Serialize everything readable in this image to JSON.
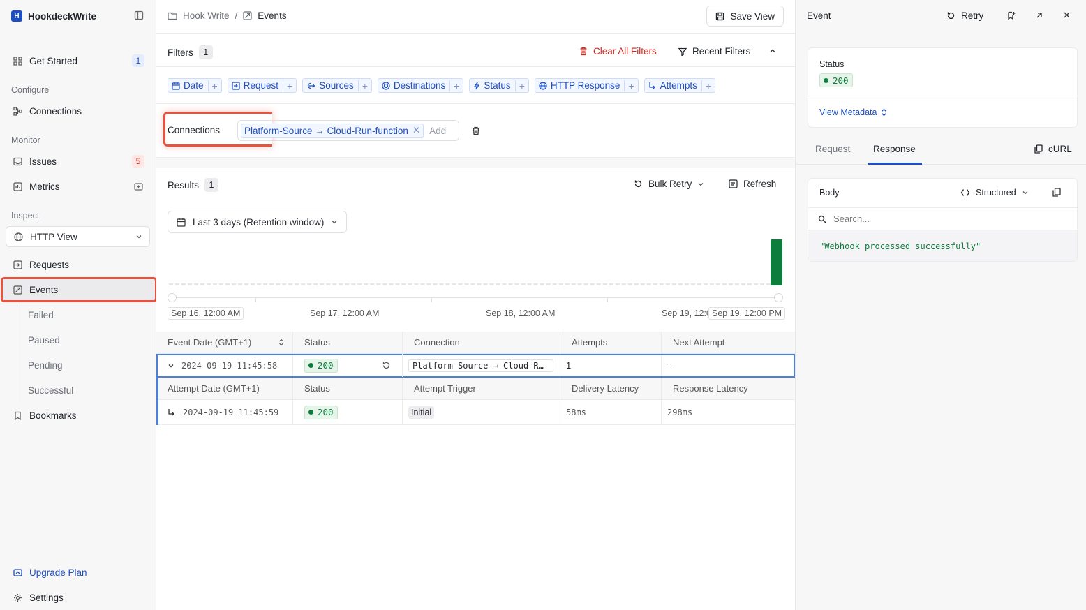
{
  "sidebar": {
    "brand": {
      "logo_letter": "H",
      "name": "HookdeckWrite"
    },
    "get_started": {
      "label": "Get Started",
      "count": "1"
    },
    "sections": {
      "configure": "Configure",
      "monitor": "Monitor",
      "inspect": "Inspect"
    },
    "connections": "Connections",
    "issues": {
      "label": "Issues",
      "count": "5"
    },
    "metrics": "Metrics",
    "http_view": "HTTP View",
    "requests": "Requests",
    "events": "Events",
    "event_subs": [
      "Failed",
      "Paused",
      "Pending",
      "Successful"
    ],
    "bookmarks": "Bookmarks",
    "upgrade": "Upgrade Plan",
    "settings": "Settings"
  },
  "header": {
    "breadcrumb_parent": "Hook Write",
    "breadcrumb_sep": "/",
    "breadcrumb_current": "Events",
    "save_view": "Save View"
  },
  "filters": {
    "label": "Filters",
    "count": "1",
    "clear_all": "Clear All Filters",
    "recent": "Recent Filters",
    "chips": [
      "Date",
      "Request",
      "Sources",
      "Destinations",
      "Status",
      "HTTP Response",
      "Attempts"
    ],
    "connections_label": "Connections",
    "connection_tag": "Platform-Source → Cloud-Run-function",
    "add_placeholder": "Add"
  },
  "results": {
    "label": "Results",
    "count": "1",
    "bulk_retry": "Bulk Retry",
    "refresh": "Refresh",
    "date_range": "Last 3 days (Retention window)",
    "axis_labels": [
      "Sep 16, 12:00 AM",
      "Sep 17, 12:00 AM",
      "Sep 18, 12:00 AM",
      "Sep 19, 12:0",
      "Sep 19, 12:00 PM"
    ]
  },
  "table": {
    "event_headers": [
      "Event Date (GMT+1)",
      "Status",
      "Connection",
      "Attempts",
      "Next Attempt"
    ],
    "event_row": {
      "date": "2024-09-19 11:45:58",
      "status": "200",
      "connection": "Platform-Source ⟶ Cloud-R…",
      "attempts": "1",
      "next_attempt": "–"
    },
    "attempt_headers": [
      "Attempt Date (GMT+1)",
      "Status",
      "Attempt Trigger",
      "Delivery Latency",
      "Response Latency"
    ],
    "attempt_row": {
      "date": "2024-09-19 11:45:59",
      "status": "200",
      "trigger": "Initial",
      "delivery_latency": "58ms",
      "response_latency": "298ms"
    }
  },
  "panel": {
    "title": "Event",
    "retry": "Retry",
    "status_label": "Status",
    "status_value": "200",
    "view_metadata": "View Metadata",
    "tabs": [
      "Request",
      "Response"
    ],
    "active_tab": "Response",
    "curl": "cURL",
    "body_label": "Body",
    "structured": "Structured",
    "search_placeholder": "Search...",
    "body_text": "\"Webhook processed successfully\""
  },
  "chart_data": {
    "type": "bar",
    "categories": [
      "Sep 19, 12:00 PM"
    ],
    "values": [
      1
    ]
  },
  "colors": {
    "accent": "#1e4fc2",
    "success": "#0d7d3d",
    "danger": "#cc2a1f",
    "highlight": "#e8533f"
  }
}
